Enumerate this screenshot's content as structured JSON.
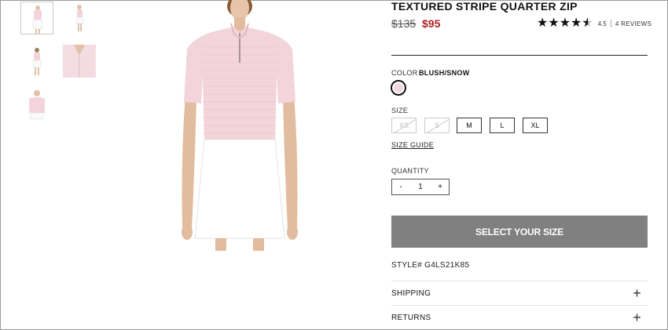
{
  "product": {
    "title": "TEXTURED STRIPE QUARTER ZIP",
    "price_original": "$135",
    "price_sale": "$95",
    "rating_value": "4.5",
    "rating_stars": 4.5,
    "review_count": "4 REVIEWS"
  },
  "color": {
    "label": "COLOR",
    "selected_name": "BLUSH/SNOW",
    "swatch_color": "#f3d7de"
  },
  "size": {
    "label": "SIZE",
    "options": [
      "XS",
      "S",
      "M",
      "L",
      "XL"
    ],
    "unavailable": [
      "XS",
      "S"
    ],
    "guide_label": "SIZE GUIDE"
  },
  "quantity": {
    "label": "QUANTITY",
    "minus": "-",
    "value": "1",
    "plus": "+"
  },
  "cta_label": "SELECT YOUR SIZE",
  "style_number": "STYLE# G4LS21K85",
  "accordions": [
    {
      "label": "SHIPPING",
      "icon": "plus-icon",
      "symbol": "+"
    },
    {
      "label": "RETURNS",
      "icon": "plus-icon",
      "symbol": "+"
    }
  ],
  "colors": {
    "sale_price": "#b01f24",
    "cta_bg": "#808080",
    "shirt": "#f2d4da",
    "skirt": "#ffffff"
  }
}
